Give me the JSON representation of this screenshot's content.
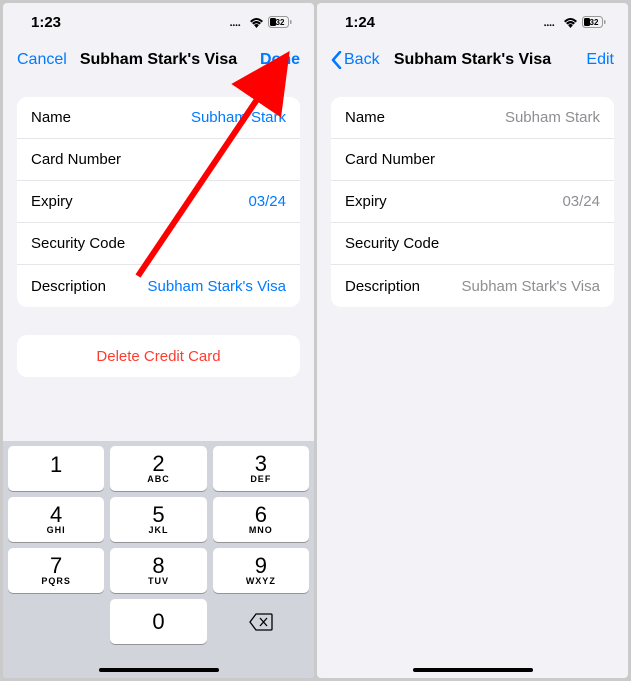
{
  "left": {
    "status": {
      "time": "1:23",
      "battery": "32"
    },
    "nav": {
      "left": "Cancel",
      "title": "Subham Stark's Visa",
      "right": "Done"
    },
    "rows": [
      {
        "label": "Name",
        "value": "Subham Stark"
      },
      {
        "label": "Card Number",
        "value": ""
      },
      {
        "label": "Expiry",
        "value": "03/24"
      },
      {
        "label": "Security Code",
        "value": ""
      },
      {
        "label": "Description",
        "value": "Subham Stark's Visa"
      }
    ],
    "delete": "Delete Credit Card",
    "keys": [
      [
        {
          "n": "1",
          "s": ""
        },
        {
          "n": "2",
          "s": "ABC"
        },
        {
          "n": "3",
          "s": "DEF"
        }
      ],
      [
        {
          "n": "4",
          "s": "GHI"
        },
        {
          "n": "5",
          "s": "JKL"
        },
        {
          "n": "6",
          "s": "MNO"
        }
      ],
      [
        {
          "n": "7",
          "s": "PQRS"
        },
        {
          "n": "8",
          "s": "TUV"
        },
        {
          "n": "9",
          "s": "WXYZ"
        }
      ],
      [
        {
          "blank": true
        },
        {
          "n": "0",
          "s": ""
        },
        {
          "backspace": true
        }
      ]
    ]
  },
  "right": {
    "status": {
      "time": "1:24",
      "battery": "32"
    },
    "nav": {
      "left": "Back",
      "title": "Subham Stark's Visa",
      "right": "Edit"
    },
    "rows": [
      {
        "label": "Name",
        "value": "Subham Stark"
      },
      {
        "label": "Card Number",
        "value": ""
      },
      {
        "label": "Expiry",
        "value": "03/24"
      },
      {
        "label": "Security Code",
        "value": ""
      },
      {
        "label": "Description",
        "value": "Subham Stark's Visa"
      }
    ]
  }
}
